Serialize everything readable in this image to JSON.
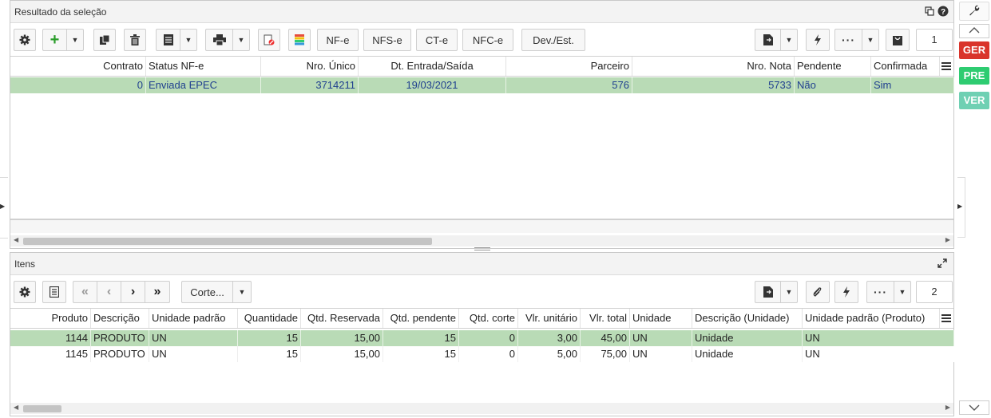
{
  "top_panel": {
    "title": "Resultado da seleção",
    "buttons": {
      "nfe": "NF-e",
      "nfse": "NFS-e",
      "cte": "CT-e",
      "nfce": "NFC-e",
      "dev": "Dev./Est."
    },
    "page": "1",
    "columns": [
      "Contrato",
      "Status NF-e",
      "Nro. Único",
      "Dt. Entrada/Saída",
      "Parceiro",
      "Nro. Nota",
      "Pendente",
      "Confirmada"
    ],
    "rows": [
      {
        "contrato": "0",
        "status": "Enviada EPEC",
        "nro_unico": "3714211",
        "dt": "19/03/2021",
        "parceiro": "576",
        "nro_nota": "5733",
        "pendente": "Não",
        "confirmada": "Sim"
      }
    ]
  },
  "items_panel": {
    "title": "Itens",
    "corte_label": "Corte...",
    "page": "2",
    "columns": [
      "Produto",
      "Descrição",
      "Unidade padrão",
      "Quantidade",
      "Qtd. Reservada",
      "Qtd. pendente",
      "Qtd. corte",
      "Vlr. unitário",
      "Vlr. total",
      "Unidade",
      "Descrição (Unidade)",
      "Unidade padrão (Produto)"
    ],
    "rows": [
      {
        "produto": "1144",
        "descricao": "PRODUTO",
        "un_padrao": "UN",
        "quantidade": "15",
        "qtd_res": "15,00",
        "qtd_pend": "15",
        "qtd_corte": "0",
        "vlr_unit": "3,00",
        "vlr_total": "45,00",
        "unidade": "UN",
        "desc_un": "Unidade",
        "un_padrao_prod": "UN"
      },
      {
        "produto": "1145",
        "descricao": "PRODUTO",
        "un_padrao": "UN",
        "quantidade": "15",
        "qtd_res": "15,00",
        "qtd_pend": "15",
        "qtd_corte": "0",
        "vlr_unit": "5,00",
        "vlr_total": "75,00",
        "unidade": "UN",
        "desc_un": "Unidade",
        "un_padrao_prod": "UN"
      }
    ]
  },
  "side": {
    "ger": "GER",
    "pre": "PRE",
    "ver": "VER"
  },
  "colors": {
    "selected_row": "#b9dbb6",
    "ger": "#d9342b",
    "pre": "#2ecc71",
    "ver": "#6fd0b3",
    "add_green": "#2a9d2a"
  }
}
